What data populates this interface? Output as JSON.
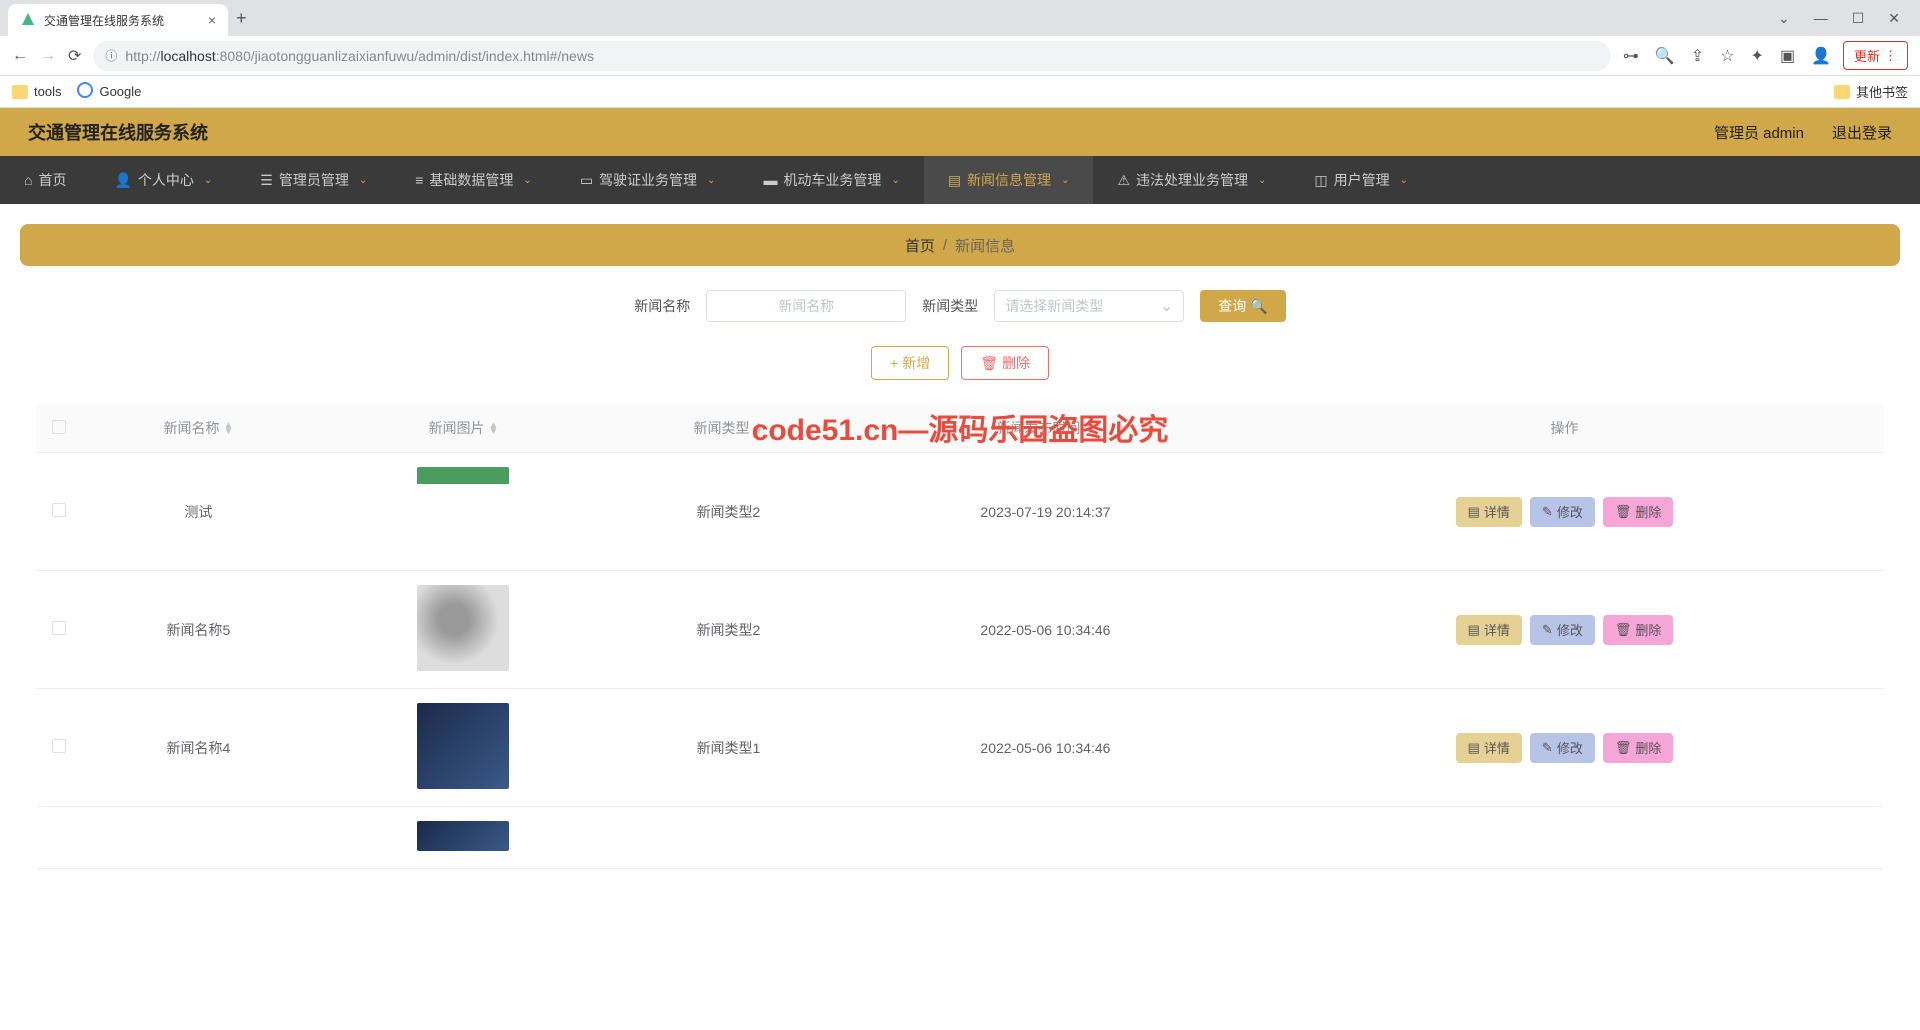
{
  "browser": {
    "tab_title": "交通管理在线服务系统",
    "url_prefix": "http://",
    "url_host": "localhost",
    "url_path": ":8080/jiaotongguanlizaixianfuwu/admin/dist/index.html#/news",
    "update_btn": "更新",
    "bookmark_tools": "tools",
    "bookmark_google": "Google",
    "bookmark_other": "其他书签"
  },
  "header": {
    "app_title": "交通管理在线服务系统",
    "admin_label": "管理员 admin",
    "logout": "退出登录"
  },
  "menu": {
    "items": [
      {
        "label": "首页",
        "has_dropdown": false
      },
      {
        "label": "个人中心",
        "has_dropdown": true
      },
      {
        "label": "管理员管理",
        "has_dropdown": true
      },
      {
        "label": "基础数据管理",
        "has_dropdown": true
      },
      {
        "label": "驾驶证业务管理",
        "has_dropdown": true
      },
      {
        "label": "机动车业务管理",
        "has_dropdown": true
      },
      {
        "label": "新闻信息管理",
        "has_dropdown": true,
        "active": true
      },
      {
        "label": "违法处理业务管理",
        "has_dropdown": true
      },
      {
        "label": "用户管理",
        "has_dropdown": true
      }
    ]
  },
  "breadcrumb": {
    "home": "首页",
    "sep": "/",
    "current": "新闻信息"
  },
  "search": {
    "name_label": "新闻名称",
    "name_placeholder": "新闻名称",
    "type_label": "新闻类型",
    "type_placeholder": "请选择新闻类型",
    "query_btn": "查询"
  },
  "actions": {
    "add": "新增",
    "delete": "删除"
  },
  "table": {
    "columns": {
      "name": "新闻名称",
      "image": "新闻图片",
      "type": "新闻类型",
      "time": "新闻发布时间",
      "op": "操作"
    },
    "op_labels": {
      "detail": "详情",
      "edit": "修改",
      "delete": "删除"
    },
    "rows": [
      {
        "name": "测试",
        "type": "新闻类型2",
        "time": "2023-07-19 20:14:37",
        "thumb": "t1"
      },
      {
        "name": "新闻名称5",
        "type": "新闻类型2",
        "time": "2022-05-06 10:34:46",
        "thumb": "t2"
      },
      {
        "name": "新闻名称4",
        "type": "新闻类型1",
        "time": "2022-05-06 10:34:46",
        "thumb": "t3"
      }
    ]
  },
  "watermark_red": "code51.cn—源码乐园盗图必究"
}
